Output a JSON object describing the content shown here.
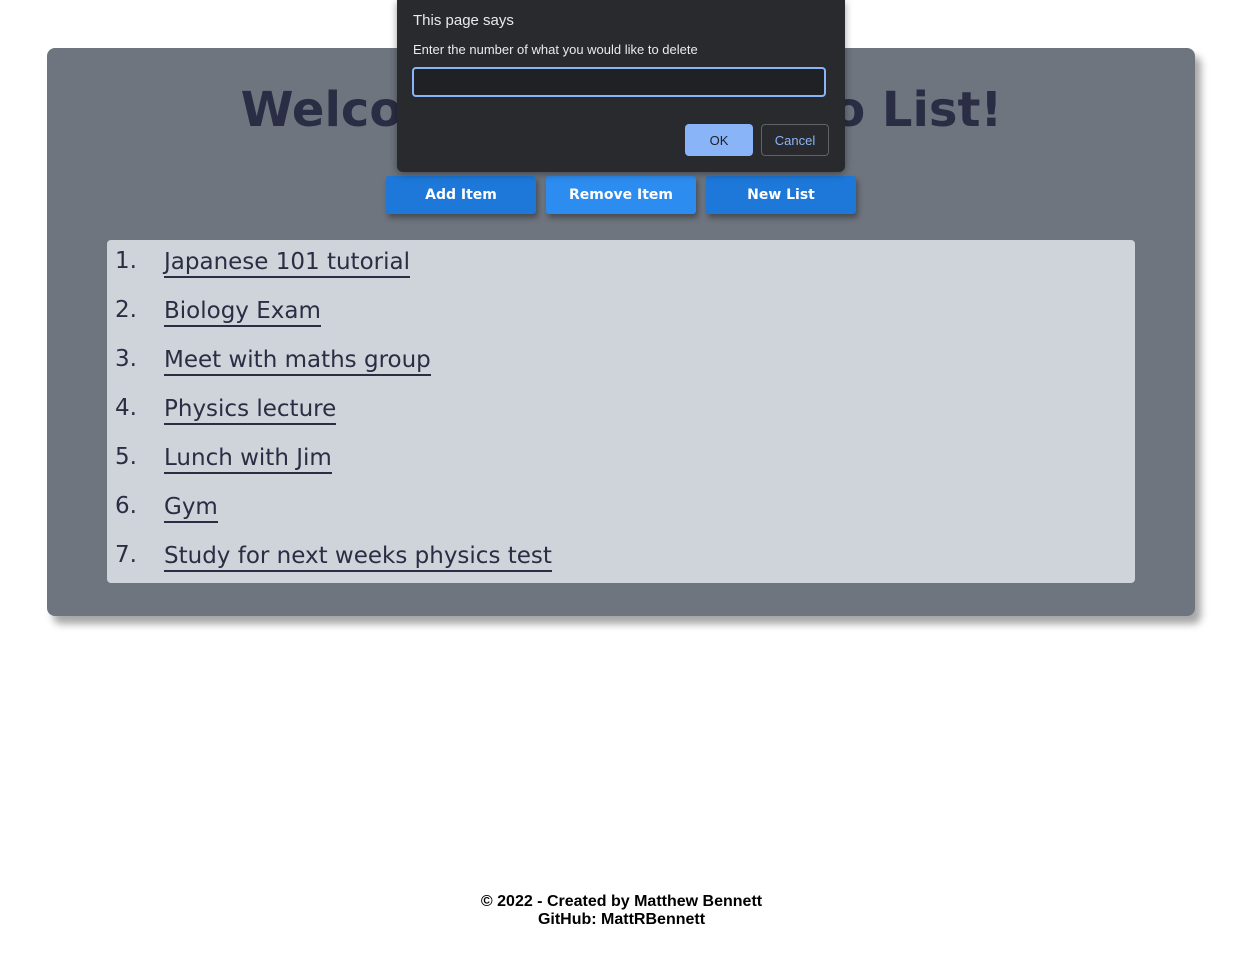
{
  "page": {
    "heading": "Welcome to your To-Do List!"
  },
  "toolbar": {
    "add_label": "Add Item",
    "remove_label": "Remove Item",
    "new_label": "New List"
  },
  "todo": {
    "items": [
      {
        "num": "1.",
        "text": "Japanese 101 tutorial"
      },
      {
        "num": "2.",
        "text": "Biology Exam"
      },
      {
        "num": "3.",
        "text": "Meet with maths group"
      },
      {
        "num": "4.",
        "text": "Physics lecture"
      },
      {
        "num": "5.",
        "text": "Lunch with Jim"
      },
      {
        "num": "6.",
        "text": "Gym"
      },
      {
        "num": "7.",
        "text": "Study for next weeks physics test"
      }
    ]
  },
  "dialog": {
    "title": "This page says",
    "message": "Enter the number of what you would like to delete",
    "input_value": "",
    "ok_label": "OK",
    "cancel_label": "Cancel"
  },
  "footer": {
    "copyright": "© 2022 - Created by Matthew Bennett",
    "github": "GitHub: MattRBennett"
  },
  "colors": {
    "card_bg": "#6e757f",
    "list_bg": "#cfd3da",
    "button_bg": "#1d78d9",
    "button_hover_bg": "#2d8cf0",
    "text_dark": "#2b2d44",
    "dialog_bg": "#292a2d",
    "dialog_accent": "#8ab4f8"
  }
}
